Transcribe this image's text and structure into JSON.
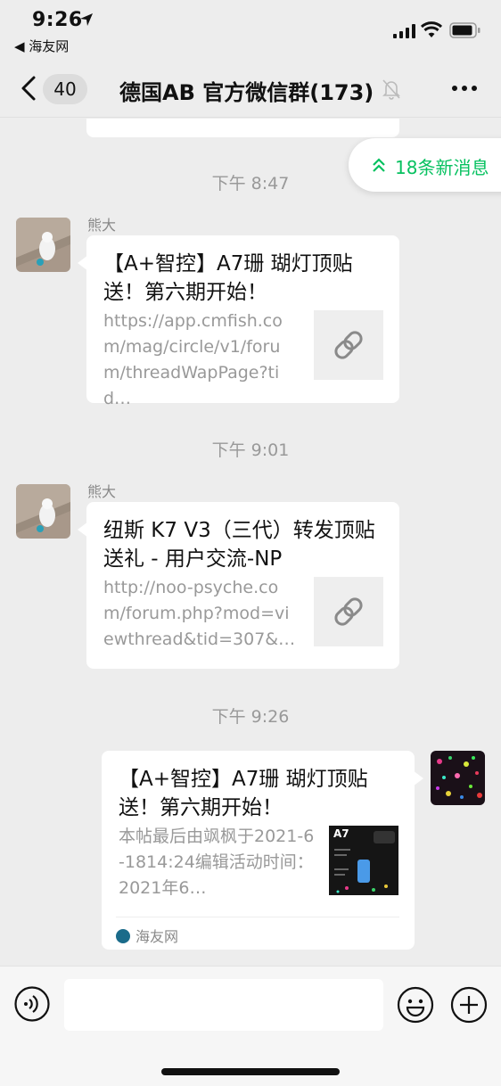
{
  "status_bar": {
    "time": "9:26",
    "back_app": "◀ 海友网"
  },
  "nav": {
    "unread_count": "40",
    "title": "德国AB  官方微信群(173)"
  },
  "new_messages_pill": "18条新消息",
  "messages": [
    {
      "time": "下午 8:47",
      "sender": "熊大",
      "title": "【A+智控】A7珊 瑚灯顶贴送！第六期开始！",
      "url": "https://app.cmfish.com/mag/circle/v1/forum/threadWapPage?tid…"
    },
    {
      "time": "下午 9:01",
      "sender": "熊大",
      "title": "纽斯 K7 V3（三代）转发顶贴送礼 - 用户交流-NP",
      "url": "http://noo-psyche.com/forum.php?mod=viewthread&tid=307&…"
    },
    {
      "time": "下午 9:26",
      "title": "【A+智控】A7珊 瑚灯顶贴送！第六期开始！",
      "desc": "本帖最后由飒枫于2021-6-1814:24编辑活动时间：2021年6…",
      "thumb_label": "A7",
      "source": "海友网"
    }
  ],
  "colors": {
    "accent": "#07c160",
    "background": "#ededed",
    "bubble": "#ffffff"
  },
  "icons": [
    "location-arrow-icon",
    "signal-icon",
    "wifi-icon",
    "battery-icon",
    "back-chevron-icon",
    "mute-bell-icon",
    "more-icon",
    "double-chevron-up-icon",
    "link-icon",
    "voice-icon",
    "emoji-icon",
    "plus-icon"
  ]
}
